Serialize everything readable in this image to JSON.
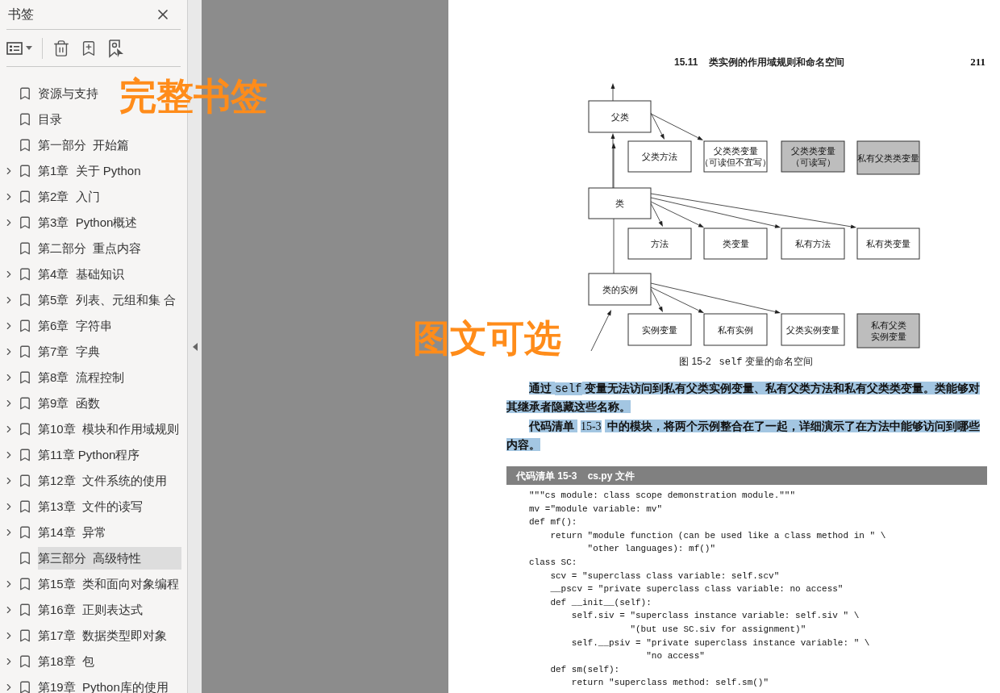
{
  "sidebar": {
    "title": "书签",
    "items": [
      {
        "label": "资源与支持",
        "kind": "leaf",
        "selected": false
      },
      {
        "label": "目录",
        "kind": "leaf",
        "selected": false
      },
      {
        "label": "第一部分  开始篇",
        "kind": "leaf",
        "selected": false
      },
      {
        "label": "第1章  关于 Python",
        "kind": "collapsible",
        "selected": false
      },
      {
        "label": "第2章  入门",
        "kind": "collapsible",
        "selected": false
      },
      {
        "label": "第3章  Python概述",
        "kind": "collapsible",
        "selected": false
      },
      {
        "label": "第二部分  重点内容",
        "kind": "leaf",
        "selected": false
      },
      {
        "label": "第4章  基础知识",
        "kind": "collapsible",
        "selected": false
      },
      {
        "label": "第5章  列表、元组和集 合",
        "kind": "collapsible",
        "selected": false
      },
      {
        "label": "第6章  字符串",
        "kind": "collapsible",
        "selected": false
      },
      {
        "label": "第7章  字典",
        "kind": "collapsible",
        "selected": false
      },
      {
        "label": "第8章  流程控制",
        "kind": "collapsible",
        "selected": false
      },
      {
        "label": "第9章  函数",
        "kind": "collapsible",
        "selected": false
      },
      {
        "label": "第10章  模块和作用域规则",
        "kind": "collapsible",
        "selected": false
      },
      {
        "label": "第11章 Python程序",
        "kind": "collapsible",
        "selected": false
      },
      {
        "label": "第12章  文件系统的使用",
        "kind": "collapsible",
        "selected": false
      },
      {
        "label": "第13章  文件的读写",
        "kind": "collapsible",
        "selected": false
      },
      {
        "label": "第14章  异常",
        "kind": "collapsible",
        "selected": false
      },
      {
        "label": "第三部分  高级特性",
        "kind": "leaf",
        "selected": true
      },
      {
        "label": "第15章  类和面向对象编程",
        "kind": "collapsible",
        "selected": false
      },
      {
        "label": "第16章  正则表达式",
        "kind": "collapsible",
        "selected": false
      },
      {
        "label": "第17章  数据类型即对象",
        "kind": "collapsible",
        "selected": false
      },
      {
        "label": "第18章  包",
        "kind": "collapsible",
        "selected": false
      },
      {
        "label": "第19章  Python库的使用",
        "kind": "collapsible",
        "selected": false
      }
    ]
  },
  "overlay_labels": [
    "完整书签",
    "图文可选"
  ],
  "page": {
    "header": "15.11    类实例的作用域规则和命名空间",
    "page_number": "211",
    "diagram": {
      "nodes": [
        {
          "lines": [
            "父类"
          ],
          "shaded": false
        },
        {
          "lines": [
            "父类方法"
          ],
          "shaded": false
        },
        {
          "lines": [
            "父类类变量",
            "（可读但不宜写）"
          ],
          "shaded": false
        },
        {
          "lines": [
            "父类类变量",
            "（可读写）"
          ],
          "shaded": true
        },
        {
          "lines": [
            "私有父类类变量"
          ],
          "shaded": true
        },
        {
          "lines": [
            "类"
          ],
          "shaded": false
        },
        {
          "lines": [
            "方法"
          ],
          "shaded": false
        },
        {
          "lines": [
            "类变量"
          ],
          "shaded": false
        },
        {
          "lines": [
            "私有方法"
          ],
          "shaded": false
        },
        {
          "lines": [
            "私有类变量"
          ],
          "shaded": false
        },
        {
          "lines": [
            "类的实例"
          ],
          "shaded": false
        },
        {
          "lines": [
            "实例变量"
          ],
          "shaded": false
        },
        {
          "lines": [
            "私有实例"
          ],
          "shaded": false
        },
        {
          "lines": [
            "父类实例变量"
          ],
          "shaded": false
        },
        {
          "lines": [
            "私有父类",
            "实例变量"
          ],
          "shaded": true
        }
      ]
    },
    "caption": {
      "prefix": "图 15-2",
      "code": "self",
      "text": "变量的命名空间"
    },
    "paragraphs": [
      [
        {
          "text": "通过 ",
          "kind": "plain"
        },
        {
          "text": "self",
          "kind": "code"
        },
        {
          "text": " 变量无法访问到私有父类实例变量、私有父类方法和私有父类类变量。类能够对其继承者隐藏这些名称。",
          "kind": "plain"
        }
      ],
      [
        {
          "text": "代码清单 ",
          "kind": "plain"
        },
        {
          "text": "15-3",
          "kind": "ref"
        },
        {
          "text": " 中的模块，将两个示例整合在了一起，详细演示了在方法中能够访问到哪些内容。",
          "kind": "plain"
        }
      ]
    ],
    "listing_title": "代码清单 15-3    cs.py 文件",
    "code_lines": [
      "\"\"\"cs module: class scope demonstration module.\"\"\"",
      "mv =\"module variable: mv\"",
      "def mf():",
      "    return \"module function (can be used like a class method in \" \\",
      "           \"other languages): mf()\"",
      "class SC:",
      "    scv = \"superclass class variable: self.scv\"",
      "    __pscv = \"private superclass class variable: no access\"",
      "    def __init__(self):",
      "        self.siv = \"superclass instance variable: self.siv \" \\",
      "                   \"(but use SC.siv for assignment)\"",
      "        self.__psiv = \"private superclass instance variable: \" \\",
      "                      \"no access\"",
      "    def sm(self):",
      "        return \"superclass method: self.sm()\""
    ]
  }
}
